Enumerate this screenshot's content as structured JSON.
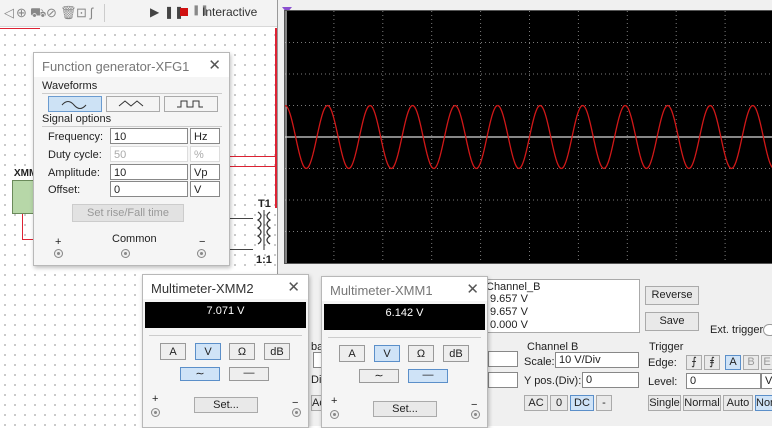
{
  "toolbar": {
    "mode_label": "Interactive"
  },
  "schematic": {
    "multimeter_ref": "XMM",
    "transformer_ref": "T1",
    "transformer_ratio": "1:1"
  },
  "function_generator": {
    "title": "Function generator-XFG1",
    "waveforms_label": "Waveforms",
    "selected_waveform": "sine",
    "signal_options_label": "Signal options",
    "fields": [
      {
        "label": "Frequency:",
        "value": "10",
        "unit": "Hz",
        "enabled": true
      },
      {
        "label": "Duty cycle:",
        "value": "50",
        "unit": "%",
        "enabled": false
      },
      {
        "label": "Amplitude:",
        "value": "10",
        "unit": "Vp",
        "enabled": true
      },
      {
        "label": "Offset:",
        "value": "0",
        "unit": "V",
        "enabled": true
      }
    ],
    "rise_fall_button": "Set rise/Fall time",
    "terminal_plus": "+",
    "terminal_common": "Common",
    "terminal_minus": "−"
  },
  "multimeter_2": {
    "title": "Multimeter-XMM2",
    "reading": "7.071 V",
    "modes": [
      "A",
      "V",
      "Ω",
      "dB"
    ],
    "selected_mode": "V",
    "signal_mode": "AC",
    "set_label": "Set...",
    "terminal_plus": "+",
    "terminal_minus": "−"
  },
  "multimeter_1": {
    "title": "Multimeter-XMM1",
    "reading": "6.142 V",
    "modes": [
      "A",
      "V",
      "Ω",
      "dB"
    ],
    "selected_mode": "V",
    "signal_mode": "DC",
    "set_label": "Set...",
    "terminal_plus": "+",
    "terminal_minus": "−"
  },
  "oscilloscope": {
    "trace_color": "#d01818",
    "waveform": "sine",
    "cycles_visible": 11.5,
    "amplitude_divisions": 1.0,
    "readout_header": "Channel_B",
    "readout_values": [
      "9.657 V",
      "9.657 V",
      "0.000 V"
    ],
    "reverse_label": "Reverse",
    "save_label": "Save",
    "ext_trigger_label": "Ext. trigger",
    "partial_labels": {
      "left_1": "bas",
      "left_2": "Di",
      "ac_cut": "Ac"
    },
    "channel_b": {
      "title": "Channel B",
      "scale_label": "Scale:",
      "scale_value": "10  V/Div",
      "ypos_label": "Y pos.(Div):",
      "ypos_value": "0",
      "coupling": [
        "AC",
        "0",
        "DC",
        "-"
      ],
      "selected_coupling": "DC"
    },
    "trigger": {
      "title": "Trigger",
      "edge_label": "Edge:",
      "edge_buttons": [
        "rising",
        "falling",
        "A",
        "B",
        "E"
      ],
      "selected_source": "A",
      "level_label": "Level:",
      "level_value": "0",
      "level_unit": "V",
      "modes": [
        "Single",
        "Normal",
        "Auto",
        "Non"
      ],
      "selected_mode": "Non"
    }
  }
}
